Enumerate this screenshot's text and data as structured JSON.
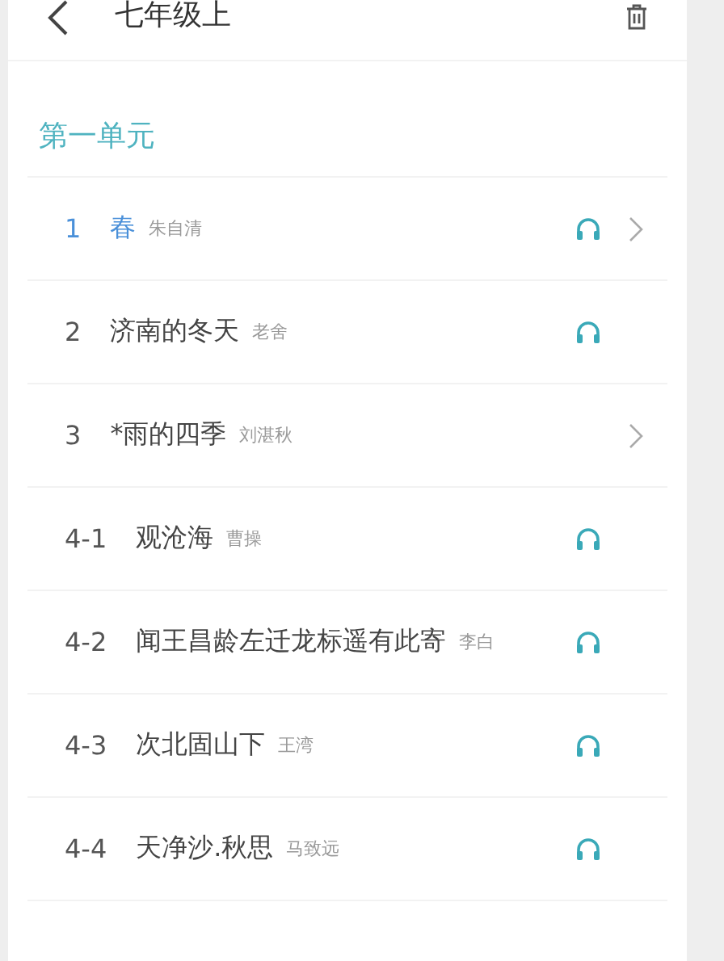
{
  "header": {
    "title": "七年级上"
  },
  "section": {
    "title": "第一单元"
  },
  "lessons": [
    {
      "number": "1",
      "title": "春",
      "author": "朱自清",
      "selected": true,
      "audio": true,
      "arrow": true
    },
    {
      "number": "2",
      "title": "济南的冬天",
      "author": "老舍",
      "selected": false,
      "audio": true,
      "arrow": false
    },
    {
      "number": "3",
      "title": "*雨的四季",
      "author": "刘湛秋",
      "selected": false,
      "audio": false,
      "arrow": true
    },
    {
      "number": "4-1",
      "title": "观沧海",
      "author": "曹操",
      "selected": false,
      "audio": true,
      "arrow": false
    },
    {
      "number": "4-2",
      "title": "闻王昌龄左迁龙标遥有此寄",
      "author": "李白",
      "selected": false,
      "audio": true,
      "arrow": false
    },
    {
      "number": "4-3",
      "title": "次北固山下",
      "author": "王湾",
      "selected": false,
      "audio": true,
      "arrow": false
    },
    {
      "number": "4-4",
      "title": "天净沙.秋思",
      "author": "马致远",
      "selected": false,
      "audio": true,
      "arrow": false
    }
  ]
}
